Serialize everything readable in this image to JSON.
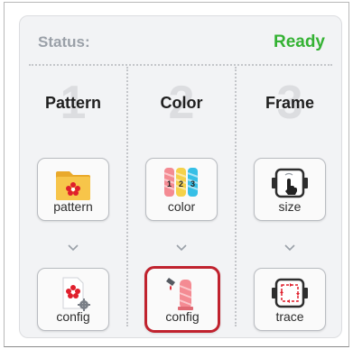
{
  "status": {
    "label": "Status:",
    "value": "Ready"
  },
  "columns": [
    {
      "number": "1",
      "title": "Pattern",
      "top_button": {
        "label": "pattern",
        "icon": "pattern-folder-icon"
      },
      "bottom_button": {
        "label": "config",
        "icon": "pattern-config-icon"
      }
    },
    {
      "number": "2",
      "title": "Color",
      "top_button": {
        "label": "color",
        "icon": "thread-spools-icon",
        "spool_numbers": [
          "1",
          "2",
          "3"
        ]
      },
      "bottom_button": {
        "label": "config",
        "icon": "color-config-icon",
        "selected": true
      }
    },
    {
      "number": "3",
      "title": "Frame",
      "top_button": {
        "label": "size",
        "icon": "frame-size-icon"
      },
      "bottom_button": {
        "label": "trace",
        "icon": "frame-trace-icon"
      }
    }
  ],
  "colors": {
    "status_ready": "#34b233",
    "selected_border": "#c0222e",
    "pattern_red": "#e01f2c",
    "folder_yellow": "#f7c54a"
  }
}
